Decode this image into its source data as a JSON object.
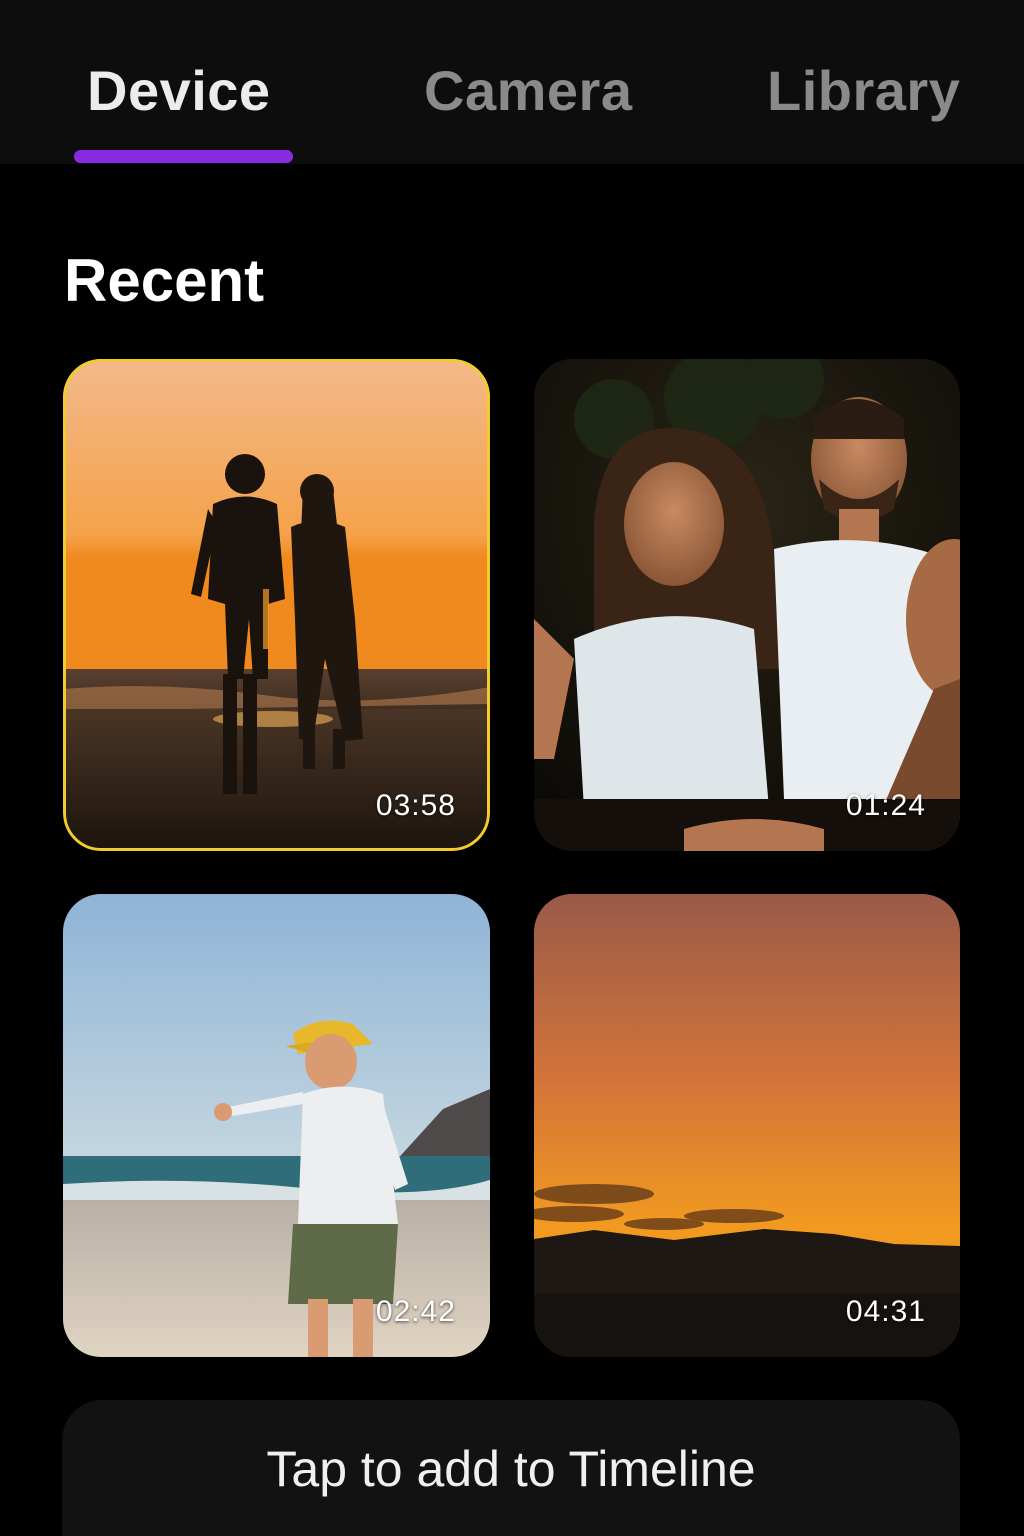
{
  "tabs": {
    "device": "Device",
    "camera": "Camera",
    "library": "Library"
  },
  "active_tab": "Device",
  "section": {
    "title": "Recent"
  },
  "media": [
    {
      "duration": "03:58",
      "selected": true,
      "scene": "couple-beach-sunset"
    },
    {
      "duration": "01:24",
      "selected": false,
      "scene": "friends-laughing-night"
    },
    {
      "duration": "02:42",
      "selected": false,
      "scene": "boy-yellow-cap-beach"
    },
    {
      "duration": "04:31",
      "selected": false,
      "scene": "orange-sky-mountains"
    }
  ],
  "action": {
    "label": "Tap to add to Timeline"
  },
  "colors": {
    "accent": "#8a2be2",
    "selection": "#f2cc2f",
    "background": "#000000"
  }
}
